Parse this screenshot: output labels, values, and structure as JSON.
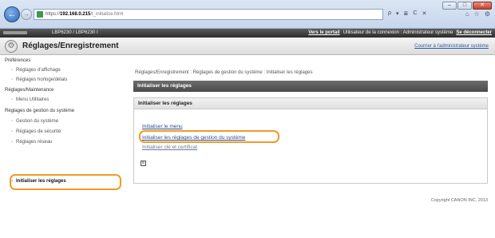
{
  "browser": {
    "url_prefix": "https://",
    "url_host": "192.168.0.215",
    "url_path": "/t_initialize.html",
    "address_tools": [
      "ρ",
      "▾",
      "≣",
      "C",
      "✕"
    ],
    "toolbar_icons": [
      "⌂",
      "☆",
      "⚙"
    ],
    "window_buttons": [
      "–",
      "□",
      "✕"
    ]
  },
  "banner": {
    "model": "LBP6230 / LBP6230 I",
    "portal_link": "Vers le portail",
    "user_text": "Utilisateur de la connexion : Administrateur système",
    "logout_link": "Se déconnecter"
  },
  "titlebar": {
    "title": "Réglages/Enregistrement",
    "mail_link": "Courrier à l'administrateur système"
  },
  "sidebar": {
    "groups": [
      {
        "label": "Préférences",
        "items": [
          "Réglages d'affichage",
          "Réglages horloge/délais"
        ]
      },
      {
        "label": "Réglages/Maintenance",
        "items": [
          "Menu Utilitaires"
        ]
      },
      {
        "label": "Réglages de gestion du système",
        "items": [
          "Gestion du système",
          "Réglages de sécurité",
          "Réglages réseau",
          "Initialiser les réglages"
        ]
      }
    ]
  },
  "main": {
    "breadcrumb": "Réglages/Enregistrement : Réglages de gestion du système : Initialiser les réglages",
    "header": "Initialiser les réglages",
    "panel_title": "Initialiser les réglages",
    "links": [
      "Initialiser le menu",
      "Initialiser les réglages de gestion du système",
      "Initialiser clé et certificat"
    ],
    "copyright": "Copyright CANON INC. 2013"
  }
}
